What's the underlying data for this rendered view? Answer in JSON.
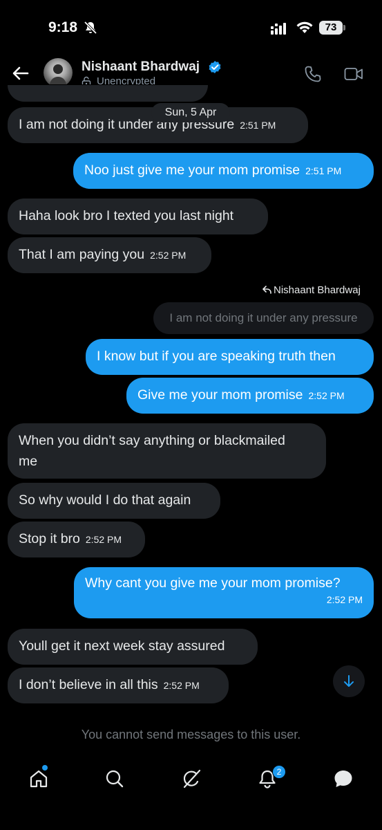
{
  "status_bar": {
    "time": "9:18",
    "battery": "73"
  },
  "header": {
    "contact_name": "Nishaant Bhardwaj",
    "encryption": "Unencrypted",
    "back_icon": "arrow-left-icon",
    "call_icon": "phone-icon",
    "video_icon": "video-icon"
  },
  "date_separator": "Sun, 5 Apr",
  "messages": [
    {
      "side": "in",
      "text": "I am not doing it under any pressure",
      "time": "2:51 PM"
    },
    {
      "side": "out",
      "text": "Noo just give me your mom promise",
      "time": "2:51 PM"
    },
    {
      "side": "in",
      "text": "Haha look bro I texted you last night",
      "time": ""
    },
    {
      "side": "in",
      "text": "That I am paying you",
      "time": "2:52 PM"
    },
    {
      "side": "out",
      "text": "I know but if you are speaking truth then",
      "time": ""
    },
    {
      "side": "out",
      "text": "Give me your mom promise",
      "time": "2:52 PM"
    },
    {
      "side": "in",
      "text": "When you didn’t say anything or blackmailed",
      "text_line2": "me",
      "time": ""
    },
    {
      "side": "in",
      "text": "So why would I do that again",
      "time": ""
    },
    {
      "side": "in",
      "text": "Stop it bro",
      "time": "2:52 PM"
    },
    {
      "side": "out",
      "text": "Why cant you give me your mom promise?",
      "time": "2:52 PM"
    },
    {
      "side": "in",
      "text": "Youll get it next week stay assured",
      "time": ""
    },
    {
      "side": "in",
      "text": "I don’t believe in all this",
      "time": "2:52 PM"
    }
  ],
  "reply": {
    "label": "Nishaant Bhardwaj",
    "quote": "I am not doing it under any pressure"
  },
  "notice": "You cannot send messages to this user.",
  "nav": {
    "items": [
      "home-icon",
      "search-icon",
      "grok-icon",
      "notifications-icon",
      "messages-icon"
    ],
    "notification_count": "2"
  },
  "colors": {
    "accent": "#1d9bf0",
    "incoming_bubble": "#202327",
    "background": "#000000"
  }
}
